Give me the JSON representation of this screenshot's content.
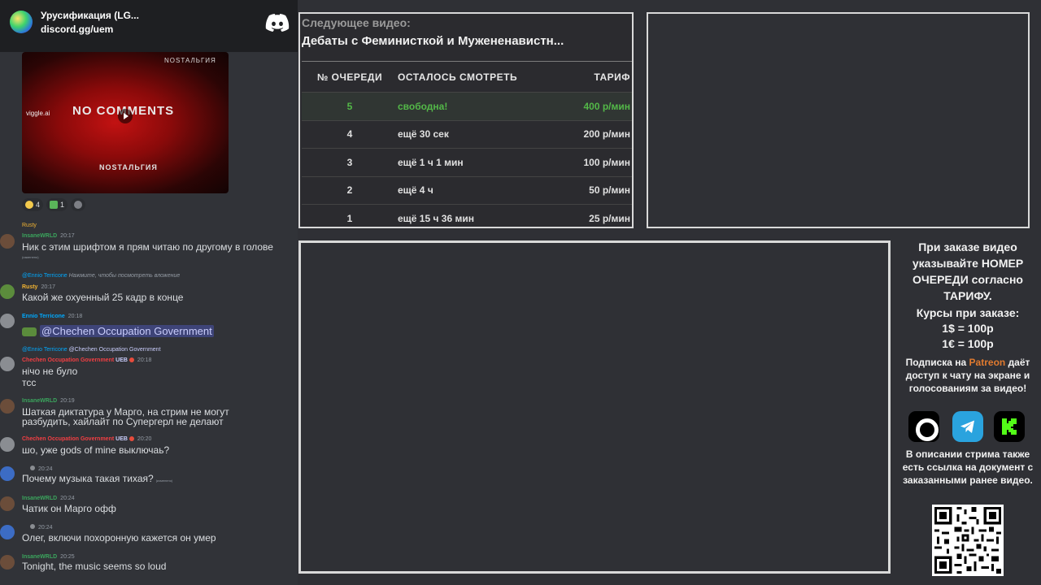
{
  "server": {
    "name": "Урусификация (LG...",
    "invite": "discord.gg/uem"
  },
  "thumbnail": {
    "title": "NO COMMENTS",
    "top_text": "NOSТАЛЬГИЯ",
    "bottom_text": "NOSТАЛЬГИЯ",
    "viggle": "viggle.ai"
  },
  "reactions": [
    {
      "count": "4"
    },
    {
      "count": "1"
    },
    {
      "count": ""
    }
  ],
  "messages": [
    {
      "reply_user": "Rusty",
      "user": "InsaneWRLD",
      "user_color": "#3ba55d",
      "time": "20:17",
      "text": "Ник с этим шрифтом я прям читаю по другому в голове",
      "edited": "(изменено)"
    },
    {
      "reply_user": "@Ennio Terricone",
      "reply_text": "Нажмите, чтобы посмотреть вложение",
      "user": "Rusty",
      "user_color": "#f0b232",
      "time": "20:17",
      "text": "Какой же охуенный 25 кадр в конце"
    },
    {
      "user": "Ennio Terricone",
      "user_color": "#00a8fc",
      "time": "20:18",
      "mention": "@Chechen Occupation Government"
    },
    {
      "reply_user": "@Ennio Terricone",
      "reply_mention": "@Chechen Occupation Government",
      "user": "Chechen Occupation Government",
      "user_color": "#f23f43",
      "tag": "UEB",
      "time": "20:18",
      "text": "нічо не було",
      "text2": "тсс"
    },
    {
      "user": "InsaneWRLD",
      "user_color": "#3ba55d",
      "time": "20:19",
      "text": "Шаткая диктатура у Марго, на стрим не могут",
      "text2": "разбудить, хайлайт по Супергерл не делают"
    },
    {
      "user": "Chechen Occupation Government",
      "user_color": "#f23f43",
      "tag": "UEB",
      "time": "20:20",
      "text": "шо, уже gods of mine выключаь?"
    },
    {
      "user": "",
      "time": "20:24",
      "text": "Почему музыка такая тихая?",
      "edited": "(изменено)"
    },
    {
      "user": "InsaneWRLD",
      "user_color": "#3ba55d",
      "time": "20:24",
      "text": "Чатик он Марго офф"
    },
    {
      "user": "",
      "time": "20:24",
      "text": "Олег, включи похоронную кажется он умер"
    },
    {
      "user": "InsaneWRLD",
      "user_color": "#3ba55d",
      "time": "20:25",
      "text": "Tonight, the music seems so loud"
    }
  ],
  "queue": {
    "next_label": "Следующее видео:",
    "next_title": "Дебаты с Феминисткой и Мужененавистн...",
    "headers": [
      "№ ОЧЕРЕДИ",
      "ОСТАЛОСЬ СМОТРЕТЬ",
      "ТАРИФ"
    ],
    "rows": [
      [
        "5",
        "свободна!",
        "400 р/мин"
      ],
      [
        "4",
        "ещё 30 сек",
        "200 р/мин"
      ],
      [
        "3",
        "ещё 1 ч 1 мин",
        "100 р/мин"
      ],
      [
        "2",
        "ещё 4 ч",
        "50 р/мин"
      ],
      [
        "1",
        "ещё 15 ч 36 мин",
        "25 р/мин"
      ]
    ]
  },
  "info": {
    "order_note": "При заказе видео указывайте НОМЕР ОЧЕРЕДИ согласно ТАРИФУ.",
    "rates_title": "Курсы при заказе:",
    "rate1": "1$ = 100р",
    "rate2": "1€ = 100р",
    "patreon_pre": "Подписка на ",
    "patreon_word": "Patreon",
    "patreon_post": " даёт доступ к чату на экране и голосованиям за видео!",
    "link_note": "В описании стрима также есть ссылка на документ с заказанными ранее видео."
  },
  "colors": {
    "free_slot": "#53b848",
    "patreon": "#e07a2f",
    "telegram": "#2aa3de",
    "kick": "#53fc18"
  }
}
